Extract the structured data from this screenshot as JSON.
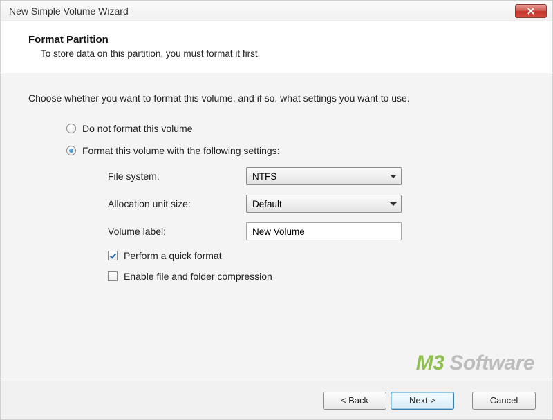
{
  "window": {
    "title": "New Simple Volume Wizard"
  },
  "header": {
    "title": "Format Partition",
    "subtitle": "To store data on this partition, you must format it first."
  },
  "body": {
    "instruction": "Choose whether you want to format this volume, and if so, what settings you want to use.",
    "radio_no_format": "Do not format this volume",
    "radio_format": "Format this volume with the following settings:",
    "file_system_label": "File system:",
    "file_system_value": "NTFS",
    "alloc_label": "Allocation unit size:",
    "alloc_value": "Default",
    "volume_label_label": "Volume label:",
    "volume_label_value": "New Volume",
    "quick_format": "Perform a quick format",
    "compression": "Enable file and folder compression"
  },
  "watermark": {
    "m3": "M3",
    "rest": " Software"
  },
  "footer": {
    "back": "< Back",
    "next": "Next >",
    "cancel": "Cancel"
  }
}
